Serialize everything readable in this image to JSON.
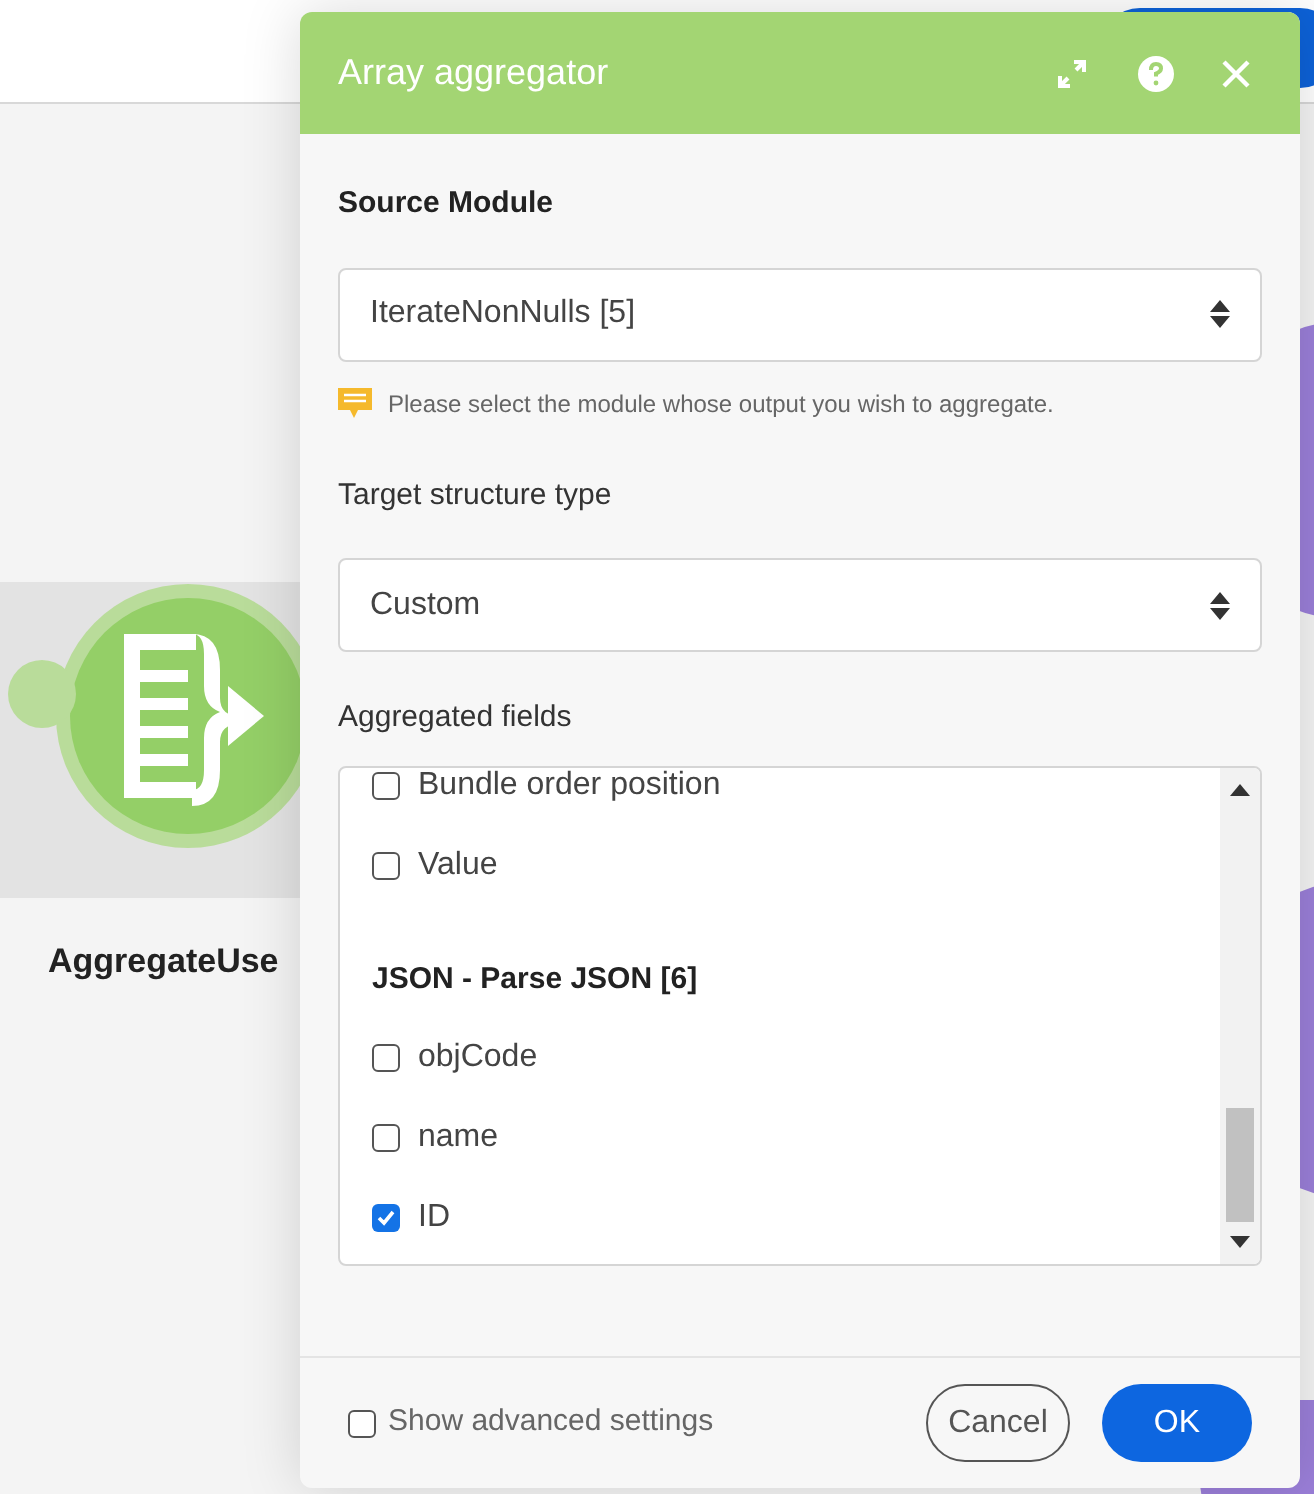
{
  "canvas": {
    "module_label": "AggregateUse"
  },
  "dialog": {
    "title": "Array aggregator",
    "sections": [
      {
        "kind": "select",
        "label": "Source Module",
        "value": "IterateNonNulls [5]",
        "hint": "Please select the module whose output you wish to aggregate."
      },
      {
        "kind": "select",
        "label": "Target structure type",
        "value": "Custom"
      }
    ],
    "aggregated_fields": {
      "label": "Aggregated fields",
      "items": [
        {
          "kind": "checkbox",
          "label": "Bundle order position",
          "checked": false
        },
        {
          "kind": "checkbox",
          "label": "Value",
          "checked": false
        },
        {
          "kind": "heading",
          "label": "JSON - Parse JSON [6]"
        },
        {
          "kind": "checkbox",
          "label": "objCode",
          "checked": false
        },
        {
          "kind": "checkbox",
          "label": "name",
          "checked": false
        },
        {
          "kind": "checkbox",
          "label": "ID",
          "checked": true
        }
      ]
    },
    "advanced": {
      "label": "Show advanced settings",
      "checked": false
    },
    "buttons": [
      {
        "kind": "secondary",
        "label": "Cancel"
      },
      {
        "kind": "primary",
        "label": "OK"
      }
    ]
  }
}
